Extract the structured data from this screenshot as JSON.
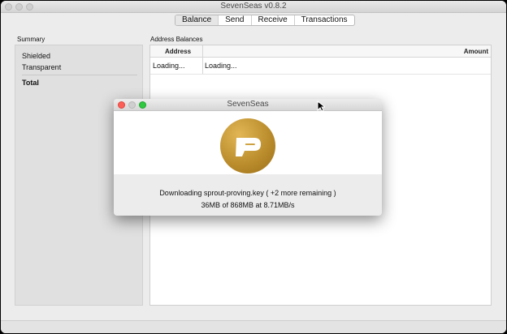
{
  "window": {
    "title": "SevenSeas v0.8.2"
  },
  "tabs": [
    "Balance",
    "Send",
    "Receive",
    "Transactions"
  ],
  "summary": {
    "heading": "Summary",
    "shielded": "Shielded",
    "transparent": "Transparent",
    "total": "Total"
  },
  "balances": {
    "heading": "Address Balances",
    "columns": [
      "Address",
      "Amount"
    ],
    "rows": [
      {
        "address": "Loading...",
        "amount": "Loading..."
      }
    ]
  },
  "dialog": {
    "title": "SevenSeas",
    "status": "Downloading sprout-proving.key ( +2 more remaining )",
    "progress": "36MB of 868MB at 8.71MB/s"
  },
  "colors": {
    "logo_gold": "#c89a35",
    "close": "#fc5f57",
    "minimize": "#cfcfcf",
    "zoom": "#2fc840"
  }
}
